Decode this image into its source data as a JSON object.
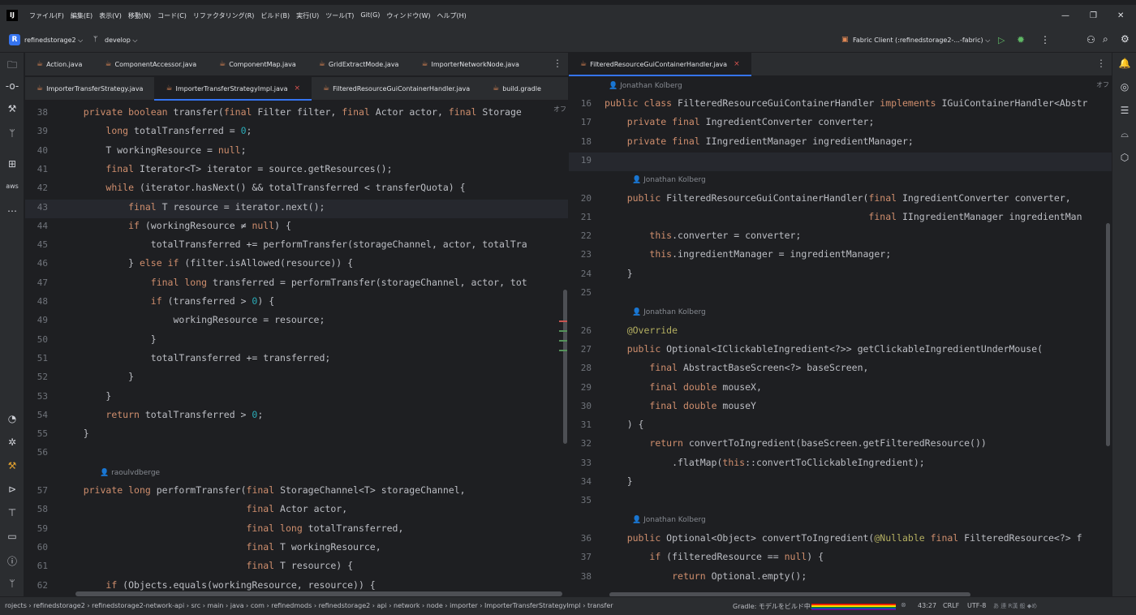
{
  "app": {
    "logo": "IJ"
  },
  "menu": [
    "ファイル(F)",
    "編集(E)",
    "表示(V)",
    "移動(N)",
    "コード(C)",
    "リファクタリング(R)",
    "ビルド(B)",
    "実行(U)",
    "ツール(T)",
    "Git(G)",
    "ウィンドウ(W)",
    "ヘルプ(H)"
  ],
  "window_controls": {
    "minimize": "—",
    "restore": "❐",
    "close": "✕"
  },
  "toolbar": {
    "project_badge": "R",
    "project": "refinedstorage2 ⌵",
    "branch": "develop ⌵",
    "run_config": "Fabric Client (:refinedstorage2-...-fabric) ⌵"
  },
  "left_pane": {
    "tabs_row1": [
      "Action.java",
      "ComponentAccessor.java",
      "ComponentMap.java",
      "GridExtractMode.java",
      "ImporterNetworkNode.java"
    ],
    "tabs_row2": [
      {
        "label": "ImporterTransferStrategy.java",
        "active": false,
        "closable": false
      },
      {
        "label": "ImporterTransferStrategyImpl.java",
        "active": true,
        "closable": true
      },
      {
        "label": "FilteredResourceGuiContainerHandler.java",
        "active": false,
        "closable": false
      },
      {
        "label": "build.gradle",
        "active": false,
        "closable": false
      }
    ],
    "more": "⋮",
    "reader_mode": "オフ",
    "author_inlay": "raoulvdberge",
    "lines": [
      {
        "n": "38",
        "code": "    private boolean transfer(final Filter filter, final Actor actor, final Storage"
      },
      {
        "n": "39",
        "code": "        long totalTransferred = 0;"
      },
      {
        "n": "40",
        "code": "        T workingResource = null;"
      },
      {
        "n": "41",
        "code": "        final Iterator<T> iterator = source.getResources();"
      },
      {
        "n": "42",
        "code": "        while (iterator.hasNext() && totalTransferred < transferQuota) {"
      },
      {
        "n": "43",
        "code": "            final T resource = iterator.next();"
      },
      {
        "n": "44",
        "code": "            if (workingResource ≠ null) {"
      },
      {
        "n": "45",
        "code": "                totalTransferred += performTransfer(storageChannel, actor, totalTra"
      },
      {
        "n": "46",
        "code": "            } else if (filter.isAllowed(resource)) {"
      },
      {
        "n": "47",
        "code": "                final long transferred = performTransfer(storageChannel, actor, tot"
      },
      {
        "n": "48",
        "code": "                if (transferred > 0) {"
      },
      {
        "n": "49",
        "code": "                    workingResource = resource;"
      },
      {
        "n": "50",
        "code": "                }"
      },
      {
        "n": "51",
        "code": "                totalTransferred += transferred;"
      },
      {
        "n": "52",
        "code": "            }"
      },
      {
        "n": "53",
        "code": "        }"
      },
      {
        "n": "54",
        "code": "        return totalTransferred > 0;"
      },
      {
        "n": "55",
        "code": "    }"
      },
      {
        "n": "56",
        "code": ""
      },
      {
        "n": "57",
        "code": "    private long performTransfer(final StorageChannel<T> storageChannel,"
      },
      {
        "n": "58",
        "code": "                                 final Actor actor,"
      },
      {
        "n": "59",
        "code": "                                 final long totalTransferred,"
      },
      {
        "n": "60",
        "code": "                                 final T workingResource,"
      },
      {
        "n": "61",
        "code": "                                 final T resource) {"
      },
      {
        "n": "62",
        "code": "        if (Objects.equals(workingResource, resource)) {"
      }
    ]
  },
  "right_pane": {
    "tab": {
      "label": "FilteredResourceGuiContainerHandler.java",
      "active": true,
      "closable": true
    },
    "more": "⋮",
    "reader_mode": "オフ",
    "author_inlay": "Jonathan Kolberg",
    "lines": [
      {
        "n": "16",
        "code": "public class FilteredResourceGuiContainerHandler implements IGuiContainerHandler<Abstr"
      },
      {
        "n": "17",
        "code": "    private final IngredientConverter converter;"
      },
      {
        "n": "18",
        "code": "    private final IIngredientManager ingredientManager;"
      },
      {
        "n": "19",
        "code": ""
      },
      {
        "n": "20",
        "code": "    public FilteredResourceGuiContainerHandler(final IngredientConverter converter,"
      },
      {
        "n": "21",
        "code": "                                               final IIngredientManager ingredientMan"
      },
      {
        "n": "22",
        "code": "        this.converter = converter;"
      },
      {
        "n": "23",
        "code": "        this.ingredientManager = ingredientManager;"
      },
      {
        "n": "24",
        "code": "    }"
      },
      {
        "n": "25",
        "code": ""
      },
      {
        "n": "26",
        "code": "    @Override"
      },
      {
        "n": "27",
        "code": "    public Optional<IClickableIngredient<?>> getClickableIngredientUnderMouse("
      },
      {
        "n": "28",
        "code": "        final AbstractBaseScreen<?> baseScreen,"
      },
      {
        "n": "29",
        "code": "        final double mouseX,"
      },
      {
        "n": "30",
        "code": "        final double mouseY"
      },
      {
        "n": "31",
        "code": "    ) {"
      },
      {
        "n": "32",
        "code": "        return convertToIngredient(baseScreen.getFilteredResource())"
      },
      {
        "n": "33",
        "code": "            .flatMap(this::convertToClickableIngredient);"
      },
      {
        "n": "34",
        "code": "    }"
      },
      {
        "n": "35",
        "code": ""
      },
      {
        "n": "36",
        "code": "    public Optional<Object> convertToIngredient(@Nullable final FilteredResource<?> f"
      },
      {
        "n": "37",
        "code": "        if (filteredResource == null) {"
      },
      {
        "n": "38",
        "code": "            return Optional.empty();"
      }
    ]
  },
  "statusbar": {
    "breadcrumbs": [
      "rojects",
      "refinedstorage2",
      "refinedstorage2-network-api",
      "src",
      "main",
      "java",
      "com",
      "refinedmods",
      "refinedstorage2",
      "api",
      "network",
      "node",
      "importer",
      "ImporterTransferStrategyImpl",
      "transfer"
    ],
    "separator": "›",
    "gradle": "Gradle: モデルをビルド中...",
    "position": "43:27",
    "line_ending": "CRLF",
    "encoding": "UTF-8",
    "ime": "あ 連 R漢 般 ◆め"
  }
}
